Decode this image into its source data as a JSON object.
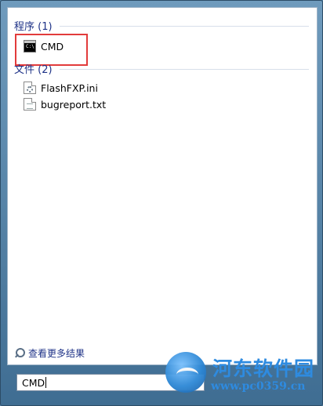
{
  "programs": {
    "header": "程序 (1)",
    "items": [
      {
        "label": "CMD",
        "icon": "cmd-icon",
        "icon_text": "C:\\"
      }
    ]
  },
  "files": {
    "header": "文件 (2)",
    "items": [
      {
        "label": "FlashFXP.ini",
        "icon": "ini-file-icon"
      },
      {
        "label": "bugreport.txt",
        "icon": "text-file-icon"
      }
    ]
  },
  "see_more": {
    "label": "查看更多结果",
    "icon": "search-icon"
  },
  "search": {
    "value": "CMD"
  },
  "watermark": {
    "title": "河东软件园",
    "url": "www.pc0359.cn",
    "logo": "globe-logo-icon"
  },
  "colors": {
    "header_text": "#1e3287",
    "highlight": "#e23b3b",
    "watermark": "#2e8be0"
  }
}
